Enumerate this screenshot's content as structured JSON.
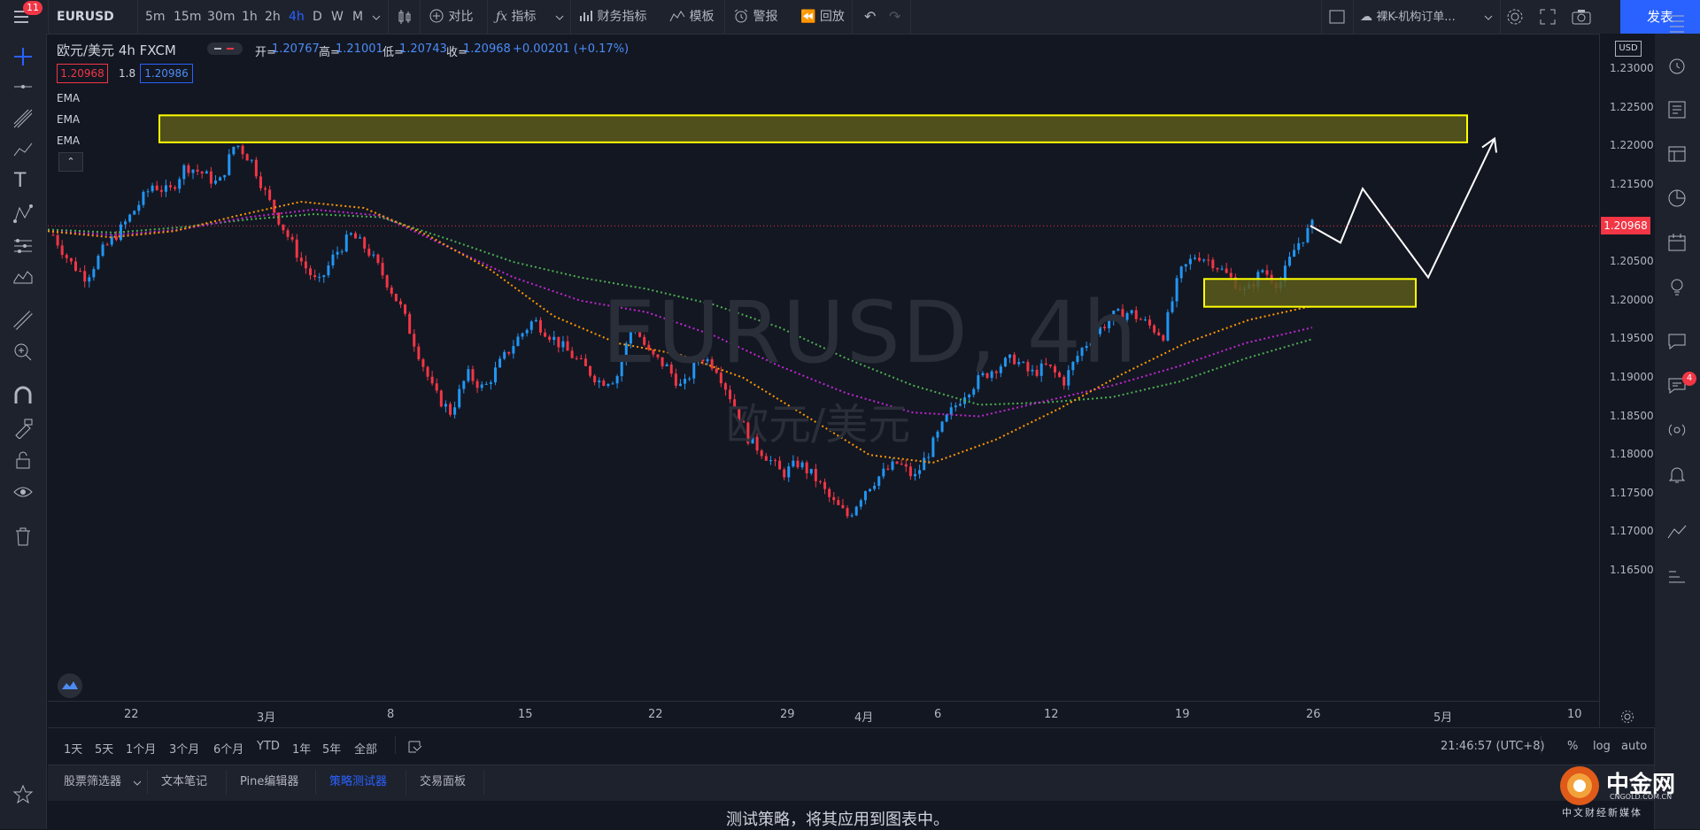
{
  "header": {
    "menu_badge": "11",
    "symbol": "EURUSD",
    "timeframes": [
      "5m",
      "15m",
      "30m",
      "1h",
      "2h",
      "4h",
      "D",
      "W",
      "M"
    ],
    "active_timeframe": "4h",
    "compare_label": "对比",
    "indicators_label": "指标",
    "financials_label": "财务指标",
    "templates_label": "模板",
    "alert_label": "警报",
    "replay_label": "回放",
    "layout_name": "裸K-机构订单...",
    "publish_label": "发表"
  },
  "legend": {
    "title": "欧元/美元  4h  FXCM",
    "open_label": "开=",
    "open": "1.20767",
    "high_label": "高=",
    "high": "1.21001",
    "low_label": "低=",
    "low": "1.20743",
    "close_label": "收=",
    "close": "1.20968",
    "change": "+0.00201 (+0.17%)",
    "bid": "1.20968",
    "spread": "1.8",
    "ask": "1.20986",
    "ema_labels": [
      "EMA",
      "EMA",
      "EMA"
    ]
  },
  "watermark": {
    "main": "EURUSD, 4h",
    "sub": "欧元/美元"
  },
  "price_axis": {
    "currency": "USD",
    "labels": [
      "1.23000",
      "1.22500",
      "1.22000",
      "1.21500",
      "1.20500",
      "1.20000",
      "1.19500",
      "1.19000",
      "1.18500",
      "1.18000",
      "1.17500",
      "1.17000",
      "1.16500"
    ],
    "current": "1.20968"
  },
  "time_axis": {
    "labels": [
      "22",
      "3月",
      "8",
      "15",
      "22",
      "29",
      "4月",
      "6",
      "12",
      "19",
      "26",
      "5月",
      "10"
    ]
  },
  "range_bar": {
    "ranges": [
      "1天",
      "5天",
      "1个月",
      "3个月",
      "6个月",
      "YTD",
      "1年",
      "5年",
      "全部"
    ],
    "clock": "21:46:57 (UTC+8)",
    "percent": "%",
    "log": "log",
    "auto": "auto"
  },
  "bottom_panel": {
    "tabs": [
      "股票筛选器",
      "文本笔记",
      "Pine编辑器",
      "策略测试器",
      "交易面板"
    ],
    "active_tab": "策略测试器",
    "message": "测试策略，将其应用到图表中。"
  },
  "right_sidebar": {
    "notification_badge": "4"
  },
  "logo": {
    "name": "中金网",
    "url": "CNGOLD.COM.CN",
    "slogan": "中文财经新媒体"
  },
  "chart_data": {
    "type": "candlestick",
    "title": "欧元/美元 4h FXCM",
    "x": [
      "22",
      "3月",
      "8",
      "15",
      "22",
      "29",
      "4月",
      "6",
      "12",
      "19",
      "26",
      "5月",
      "10"
    ],
    "ylim": [
      1.165,
      1.235
    ],
    "close_path": [
      1.2085,
      1.205,
      1.203,
      1.2065,
      1.209,
      1.212,
      1.215,
      1.214,
      1.2175,
      1.2165,
      1.215,
      1.2205,
      1.218,
      1.213,
      1.209,
      1.205,
      1.202,
      1.206,
      1.2085,
      1.2065,
      1.203,
      1.199,
      1.1935,
      1.188,
      1.1855,
      1.1905,
      1.1885,
      1.192,
      1.195,
      1.1975,
      1.1955,
      1.1935,
      1.1915,
      1.1895,
      1.19,
      1.197,
      1.193,
      1.1915,
      1.1885,
      1.193,
      1.1915,
      1.187,
      1.182,
      1.18,
      1.1775,
      1.179,
      1.177,
      1.174,
      1.172,
      1.1755,
      1.1775,
      1.179,
      1.177,
      1.181,
      1.185,
      1.188,
      1.19,
      1.1915,
      1.1925,
      1.1905,
      1.1915,
      1.1895,
      1.1935,
      1.196,
      1.198,
      1.1985,
      1.197,
      1.1955,
      1.2035,
      1.206,
      1.205,
      1.203,
      1.201,
      1.204,
      1.202,
      1.207,
      1.2097
    ],
    "ema_fast": [
      1.209,
      1.2082,
      1.209,
      1.211,
      1.2128,
      1.212,
      1.2085,
      1.204,
      1.198,
      1.1945,
      1.193,
      1.19,
      1.185,
      1.18,
      1.179,
      1.182,
      1.186,
      1.1905,
      1.1945,
      1.1975,
      1.1993
    ],
    "ema_mid": [
      1.209,
      1.2085,
      1.2092,
      1.2108,
      1.2118,
      1.211,
      1.207,
      1.203,
      1.2,
      1.1985,
      1.1955,
      1.1915,
      1.188,
      1.1855,
      1.185,
      1.187,
      1.189,
      1.1915,
      1.1945,
      1.1965
    ],
    "ema_slow": [
      1.2092,
      1.2088,
      1.2095,
      1.2105,
      1.2112,
      1.2108,
      1.208,
      1.205,
      1.203,
      1.2015,
      1.1995,
      1.1965,
      1.1925,
      1.189,
      1.1865,
      1.1868,
      1.1875,
      1.1895,
      1.1925,
      1.195
    ],
    "zones": [
      {
        "from": 1.2205,
        "to": 1.224
      },
      {
        "from": 1.1992,
        "to": 1.2028
      }
    ],
    "projection": [
      1.2097,
      1.2075,
      1.2145,
      1.203,
      1.221
    ],
    "current_price": 1.20968,
    "colors": {
      "up": "#2196f3",
      "down": "#f23645",
      "ema_fast": "#ff9800",
      "ema_mid": "#c026d3",
      "ema_slow": "#4caf50",
      "zone_fill": "#5a5a1a",
      "zone_border": "#ffff00",
      "projection": "#ffffff"
    }
  }
}
